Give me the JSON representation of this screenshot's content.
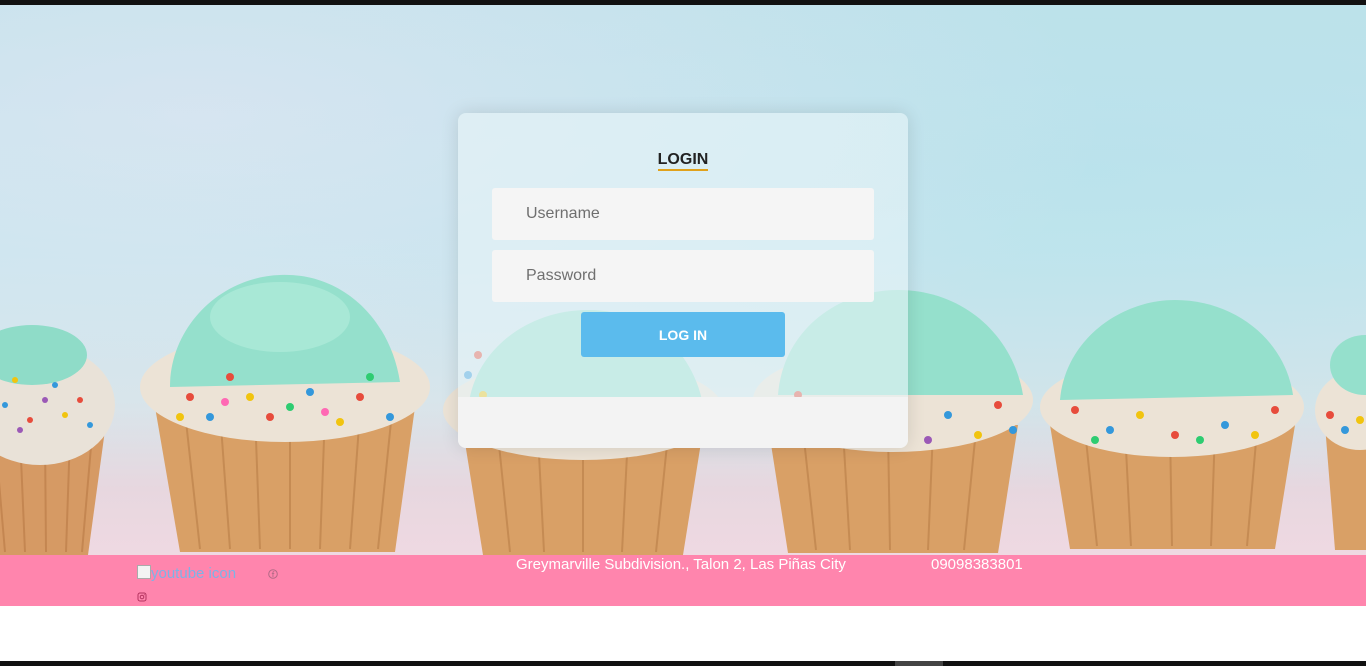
{
  "login": {
    "title": "LOGIN",
    "username_placeholder": "Username",
    "password_placeholder": "Password",
    "button_label": "LOG IN"
  },
  "footer": {
    "youtube_alt": "youtube icon",
    "address": "Greymarville Subdivision., Talon 2, Las Piñas City",
    "phone": "09098383801",
    "icons": [
      "youtube-icon",
      "facebook-icon",
      "instagram-icon"
    ]
  },
  "colors": {
    "accent_button": "#5bbbed",
    "footer_bg": "#ff85ad",
    "title_underline": "#e0a11b"
  }
}
